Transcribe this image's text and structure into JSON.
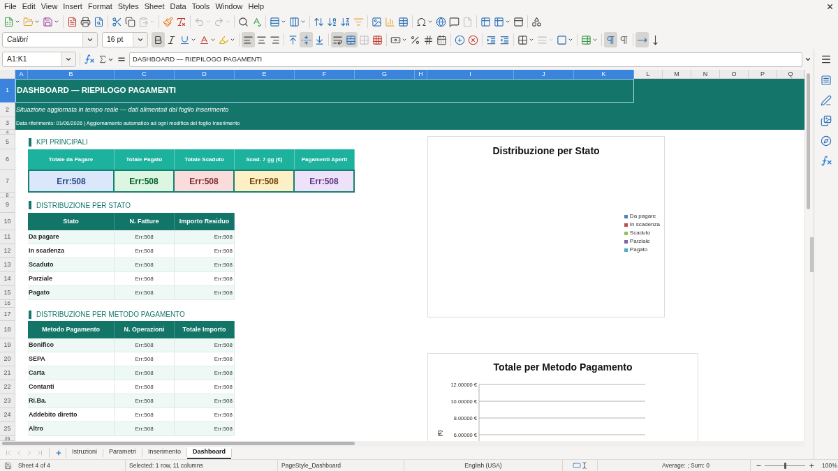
{
  "menu_bar": [
    "File",
    "Edit",
    "View",
    "Insert",
    "Format",
    "Styles",
    "Sheet",
    "Data",
    "Tools",
    "Window",
    "Help"
  ],
  "standard_toolbar": {
    "paste_disabled": true,
    "undo_disabled": true,
    "redo_disabled": true,
    "header_footer_disabled": true
  },
  "formatting_toolbar": {
    "font_name": "Calibri",
    "font_size": "16 pt",
    "bold": true,
    "italic": false,
    "underline": false,
    "align_left": true,
    "align_center": false,
    "align_right": false,
    "align_top": false,
    "center_vertically": true,
    "align_bottom": false,
    "wrap_text": true,
    "merge_and_center": true,
    "merge_cells_disabled": true,
    "border_style_disabled": true,
    "left_to_right": true,
    "right_to_left": false,
    "horizontal_text": true,
    "vertical_text": false
  },
  "formula_bar": {
    "name_box": "A1:K1",
    "content": "DASHBOARD — RIEPILOGO PAGAMENTI"
  },
  "sheet": {
    "columns": [
      {
        "label": "A",
        "selected": true
      },
      {
        "label": "B",
        "selected": true
      },
      {
        "label": "C",
        "selected": true
      },
      {
        "label": "D",
        "selected": true
      },
      {
        "label": "E",
        "selected": true
      },
      {
        "label": "F",
        "selected": true
      },
      {
        "label": "G",
        "selected": true
      },
      {
        "label": "H",
        "selected": true
      },
      {
        "label": "I",
        "selected": true
      },
      {
        "label": "J",
        "selected": true
      },
      {
        "label": "K",
        "selected": true
      },
      {
        "label": "L",
        "selected": false
      },
      {
        "label": "M",
        "selected": false
      },
      {
        "label": "N",
        "selected": false
      },
      {
        "label": "O",
        "selected": false
      },
      {
        "label": "P",
        "selected": false
      },
      {
        "label": "Q",
        "selected": false
      }
    ],
    "rows": [
      {
        "label": "1",
        "selected": true
      },
      {
        "label": "2",
        "selected": false
      },
      {
        "label": "3",
        "selected": false
      },
      {
        "label": "4",
        "selected": false
      },
      {
        "label": "5",
        "selected": false
      },
      {
        "label": "6",
        "selected": false
      },
      {
        "label": "7",
        "selected": false
      },
      {
        "label": "8",
        "selected": false
      },
      {
        "label": "9",
        "selected": false
      },
      {
        "label": "10",
        "selected": false
      },
      {
        "label": "11",
        "selected": false
      },
      {
        "label": "12",
        "selected": false
      },
      {
        "label": "13",
        "selected": false
      },
      {
        "label": "14",
        "selected": false
      },
      {
        "label": "15",
        "selected": false
      },
      {
        "label": "16",
        "selected": false
      },
      {
        "label": "17",
        "selected": false
      },
      {
        "label": "18",
        "selected": false
      },
      {
        "label": "19",
        "selected": false
      },
      {
        "label": "20",
        "selected": false
      },
      {
        "label": "21",
        "selected": false
      },
      {
        "label": "22",
        "selected": false
      },
      {
        "label": "23",
        "selected": false
      },
      {
        "label": "24",
        "selected": false
      },
      {
        "label": "25",
        "selected": false
      },
      {
        "label": "26",
        "selected": false
      }
    ],
    "title": "DASHBOARD — RIEPILOGO PAGAMENTI",
    "subtitle": "Situazione aggiornata in tempo reale — dati alimentati dal foglio Inserimento",
    "info": "Data riferimento: 01/06/2026 | Aggiornamento automatico ad ogni modifica del foglio Inserimento",
    "kpi": {
      "heading": "KPI PRINCIPALI",
      "items": [
        {
          "label": "Totale da Pagare",
          "value": "Err:508",
          "color": "#dbe7fb"
        },
        {
          "label": "Totale Pagato",
          "value": "Err:508",
          "color": "#dcf6e2"
        },
        {
          "label": "Totale Scaduto",
          "value": "Err:508",
          "color": "#fbdcdc"
        },
        {
          "label": "Scad. 7 gg (€)",
          "value": "Err:508",
          "color": "#fdf0c6"
        },
        {
          "label": "Pagamenti Aperti",
          "value": "Err:508",
          "color": "#eee2fb"
        }
      ]
    },
    "tables": [
      {
        "heading": "DISTRIBUZIONE PER STATO",
        "columns": [
          "Stato",
          "N. Fatture",
          "Importo Residuo"
        ],
        "rows": [
          [
            "Da pagare",
            "Err:508",
            "Err:508"
          ],
          [
            "In scadenza",
            "Err:508",
            "Err:508"
          ],
          [
            "Scaduto",
            "Err:508",
            "Err:508"
          ],
          [
            "Parziale",
            "Err:508",
            "Err:508"
          ],
          [
            "Pagato",
            "Err:508",
            "Err:508"
          ]
        ]
      },
      {
        "heading": "DISTRIBUZIONE PER METODO PAGAMENTO",
        "columns": [
          "Metodo Pagamento",
          "N. Operazioni",
          "Totale Importo"
        ],
        "rows": [
          [
            "Bonifico",
            "Err:508",
            "Err:508"
          ],
          [
            "SEPA",
            "Err:508",
            "Err:508"
          ],
          [
            "Carta",
            "Err:508",
            "Err:508"
          ],
          [
            "Contanti",
            "Err:508",
            "Err:508"
          ],
          [
            "Ri.Ba.",
            "Err:508",
            "Err:508"
          ],
          [
            "Addebito diretto",
            "Err:508",
            "Err:508"
          ],
          [
            "Altro",
            "Err:508",
            "Err:508"
          ]
        ]
      }
    ],
    "pie_chart": {
      "legend": [
        {
          "label": "Da pagare",
          "color": "#4f81bd"
        },
        {
          "label": "In scadenza",
          "color": "#c0504d"
        },
        {
          "label": "Scaduto",
          "color": "#9bbb59"
        },
        {
          "label": "Parziale",
          "color": "#8064a2"
        },
        {
          "label": "Pagato",
          "color": "#4bacc6"
        }
      ],
      "chart_data": {
        "type": "pie",
        "title": "Distribuzione per Stato"
      }
    },
    "method_chart": {
      "title": "Totale per Metodo Pagamento",
      "axis_title": "(€)",
      "axis_labels": [
        "12.00000 €",
        "10.00000 €",
        "8.00000 €",
        "6.00000 €"
      ]
    }
  },
  "sheet_tabs": {
    "navigation_disabled": true,
    "tabs": [
      {
        "label": "Istruzioni",
        "selected": false
      },
      {
        "label": "Parametri",
        "selected": false
      },
      {
        "label": "Inserimento",
        "selected": false
      },
      {
        "label": "Dashboard",
        "selected": true
      }
    ]
  },
  "status_bar": {
    "sheet": "Sheet 4 of 4",
    "selection": "Selected: 1 row, 11 columns",
    "page_style": "PageStyle_Dashboard",
    "language": "English (USA)",
    "summary": "Average: ; Sum: 0",
    "zoom": {
      "level": 0.5,
      "reading": "100%"
    }
  }
}
